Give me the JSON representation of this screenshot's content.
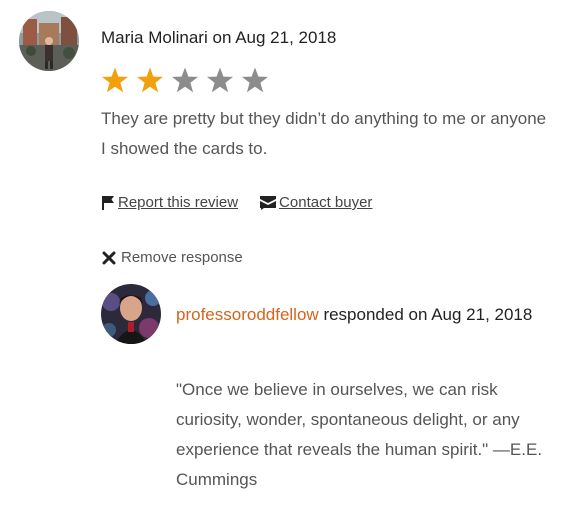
{
  "review": {
    "reviewer_name": "Maria Molinari",
    "on_word": "on",
    "date": "Aug 21, 2018",
    "rating": 2,
    "max_rating": 5,
    "text": "They are pretty but they didn’t do anything to me or anyone I showed the cards to.",
    "colors": {
      "star_filled": "#f1a10d",
      "star_empty": "#8c8c8c"
    }
  },
  "actions": {
    "report_label": "Report this review",
    "contact_label": "Contact buyer",
    "remove_response_label": "Remove response"
  },
  "response": {
    "shop_name": "professoroddfellow",
    "responded_text": "responded on Aug 21, 2018",
    "text": "\"Once we believe in ourselves, we can risk curiosity, wonder, spontaneous delight, or any experience that reveals the human spirit.\" —E.E. Cummings",
    "colors": {
      "shop_link": "#d5641c"
    }
  },
  "icons": {
    "report": "flag-icon",
    "contact": "message-icon",
    "remove": "close-icon"
  }
}
